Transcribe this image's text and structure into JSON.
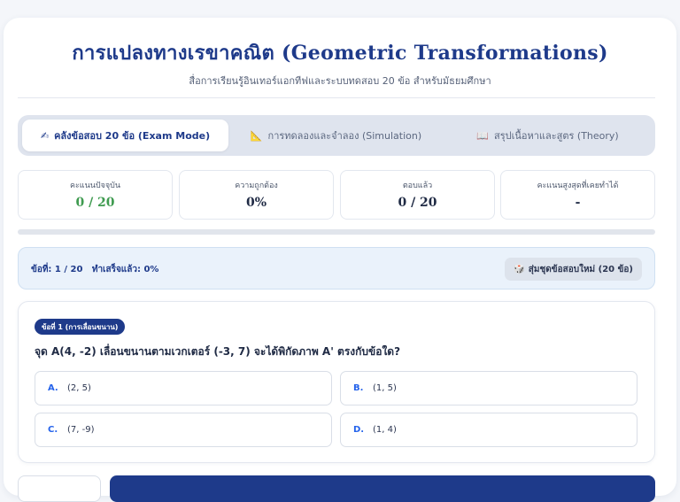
{
  "header": {
    "title": "การแปลงทางเรขาคณิต (Geometric Transformations)",
    "subtitle": "สื่อการเรียนรู้อินเทอร์แอกทีฟและระบบทดสอบ 20 ข้อ สำหรับมัธยมศึกษา"
  },
  "tabs": [
    {
      "icon": "✍",
      "icon_name": "writing-hand-icon",
      "label": "คลังข้อสอบ 20 ข้อ (Exam Mode)",
      "active": true
    },
    {
      "icon": "📐",
      "icon_name": "triangle-ruler-icon",
      "label": "การทดลองและจำลอง (Simulation)",
      "active": false
    },
    {
      "icon": "📖",
      "icon_name": "open-book-icon",
      "label": "สรุปเนื้อหาและสูตร (Theory)",
      "active": false
    }
  ],
  "stats": [
    {
      "label": "คะแนนปัจจุบัน",
      "value": "0 / 20"
    },
    {
      "label": "ความถูกต้อง",
      "value": "0%"
    },
    {
      "label": "ตอบแล้ว",
      "value": "0 / 20"
    },
    {
      "label": "คะแนนสูงสุดที่เคยทำได้",
      "value": "-"
    }
  ],
  "colors": {
    "accent": "#1e3a8a",
    "score_green": "#3f9b50",
    "option_key": "#2563eb"
  },
  "progress": {
    "fraction": 0
  },
  "status": {
    "text": "ข้อที่: 1 / 20   ทำเสร็จแล้ว: 0%",
    "shuffle_icon": "🎲",
    "shuffle_icon_name": "dice-icon",
    "shuffle_label": "สุ่มชุดข้อสอบใหม่ (20 ข้อ)"
  },
  "question": {
    "badge": "ข้อที่ 1 (การเลื่อนขนาน)",
    "text": "จุด A(4, -2) เลื่อนขนานตามเวกเตอร์ (-3, 7) จะได้พิกัดภาพ A' ตรงกับข้อใด?",
    "options": [
      {
        "key": "A.",
        "value": "(2, 5)"
      },
      {
        "key": "B.",
        "value": "(1, 5)"
      },
      {
        "key": "C.",
        "value": "(7, -9)"
      },
      {
        "key": "D.",
        "value": "(1, 4)"
      }
    ]
  }
}
